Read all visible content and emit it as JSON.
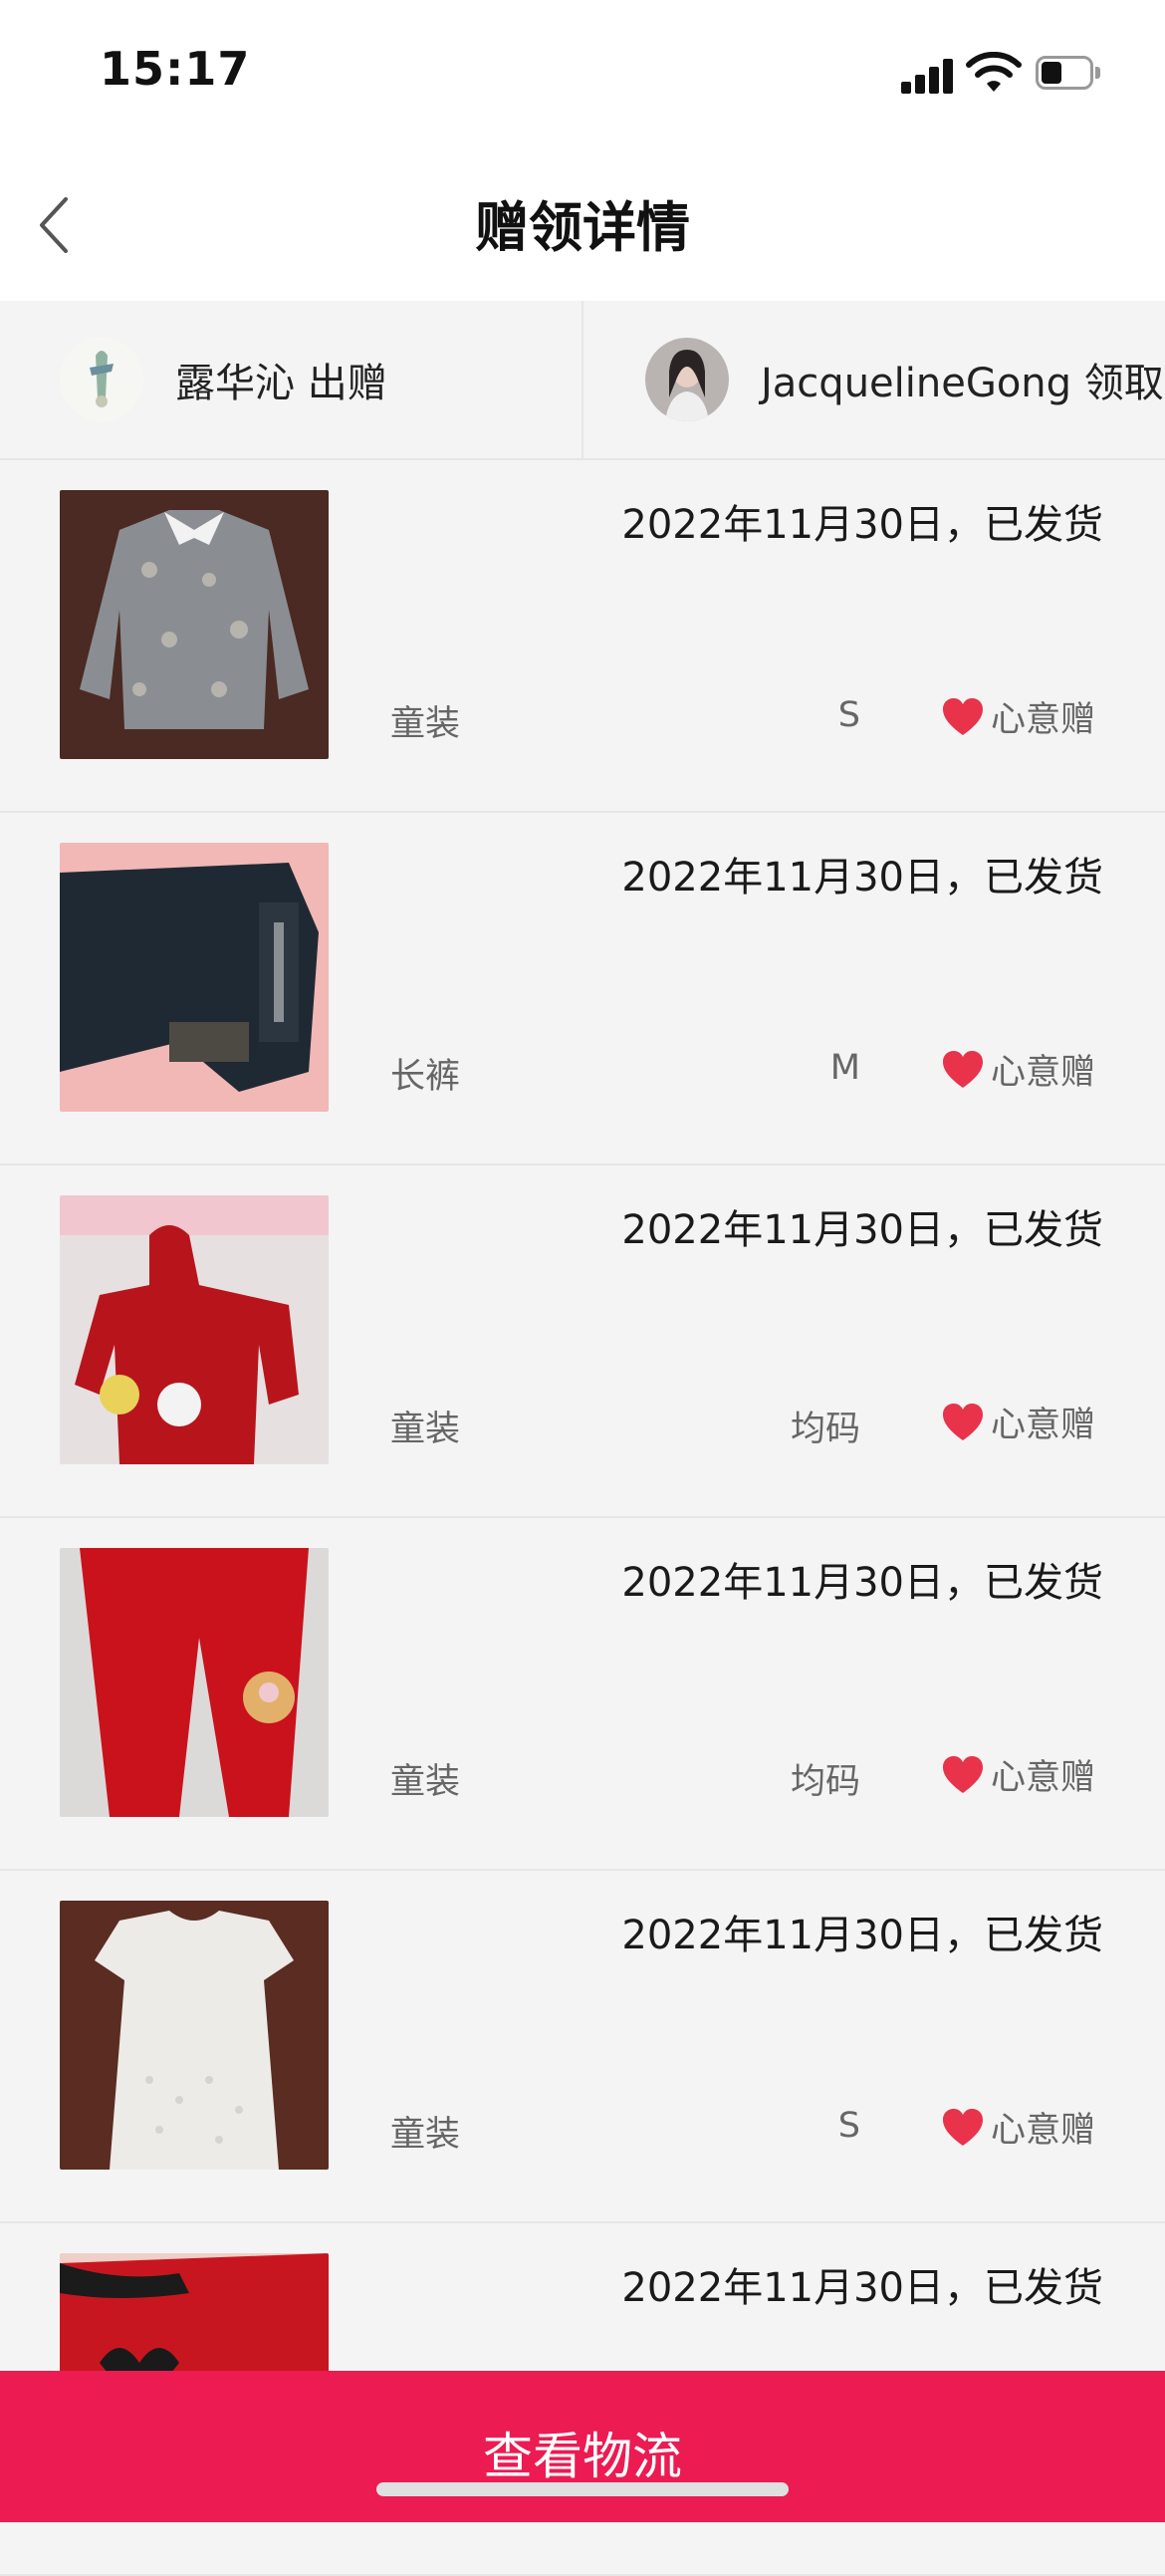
{
  "status_bar": {
    "time": "15:17"
  },
  "nav": {
    "title": "赠领详情"
  },
  "parties": {
    "giver": {
      "name_action": "露华沁 出赠",
      "avatar": "giver-avatar"
    },
    "receiver": {
      "name_action": "JacquelineGong 领取",
      "avatar": "receiver-avatar"
    }
  },
  "items": [
    {
      "status": "2022年11月30日，已发货",
      "category": "童装",
      "size": "S",
      "gift_type": "心意赠",
      "image": "floral-shirt"
    },
    {
      "status": "2022年11月30日，已发货",
      "category": "长裤",
      "size": "M",
      "gift_type": "心意赠",
      "image": "dark-jeans"
    },
    {
      "status": "2022年11月30日，已发货",
      "category": "童装",
      "size": "均码",
      "gift_type": "心意赠",
      "image": "red-hooded-jacket"
    },
    {
      "status": "2022年11月30日，已发货",
      "category": "童装",
      "size": "均码",
      "gift_type": "心意赠",
      "image": "red-padded-pants"
    },
    {
      "status": "2022年11月30日，已发货",
      "category": "童装",
      "size": "S",
      "gift_type": "心意赠",
      "image": "white-lace-dress"
    },
    {
      "status": "2022年11月30日，已发货",
      "category": "",
      "size": "",
      "gift_type": "",
      "image": "red-top"
    }
  ],
  "bottom_button": {
    "label": "查看物流"
  },
  "colors": {
    "accent": "#ec1b52",
    "heart": "#e8334a",
    "background": "#f4f4f4"
  }
}
